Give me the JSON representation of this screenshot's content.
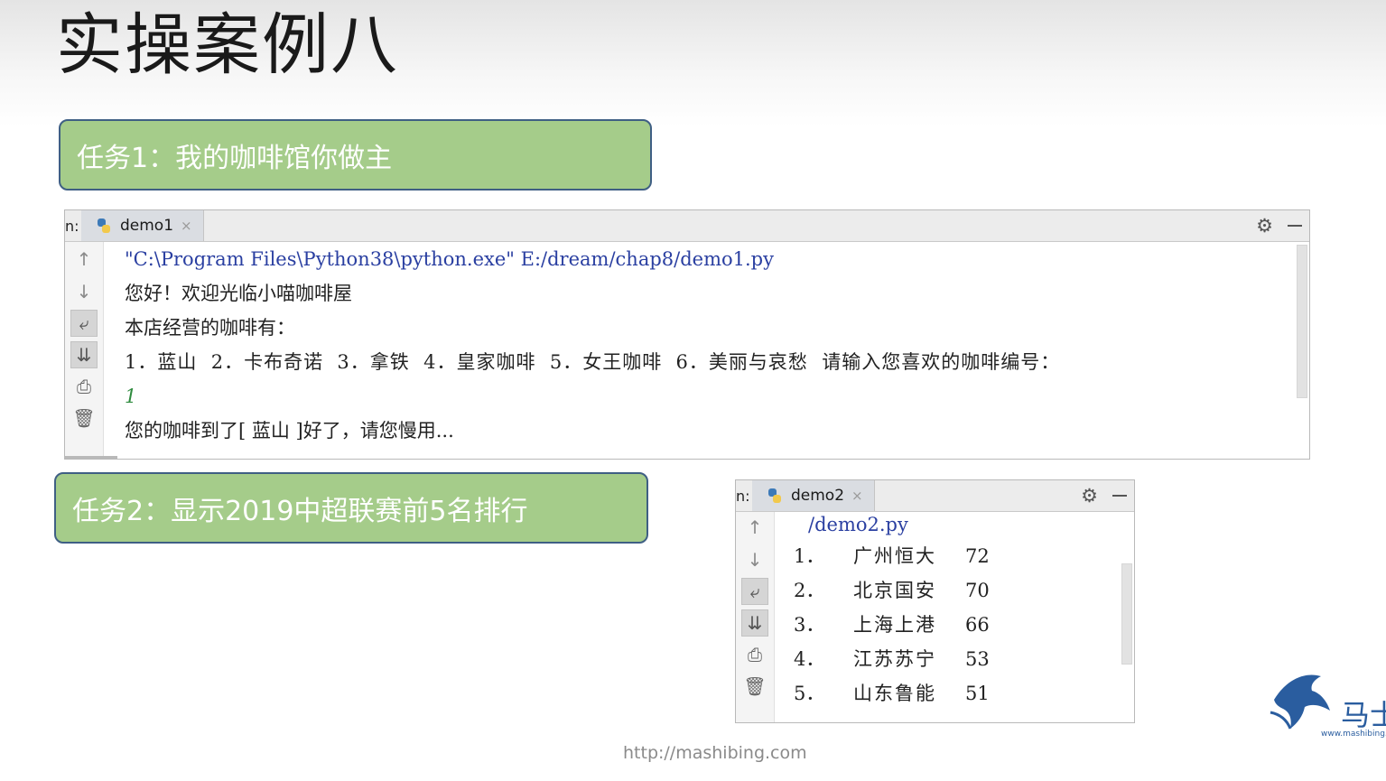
{
  "slide": {
    "title": "实操案例八",
    "footer_url": "http://mashibing.com"
  },
  "task1": {
    "label": "任务1：我的咖啡馆你做主"
  },
  "task2": {
    "label": "任务2：显示2019中超联赛前5名排行"
  },
  "panel1": {
    "tab_prefix": "n:",
    "tab_name": "demo1",
    "lines": [
      "\"C:\\Program Files\\Python38\\python.exe\" E:/dream/chap8/demo1.py",
      "您好！欢迎光临小喵咖啡屋",
      "本店经营的咖啡有：",
      "1．蓝山  2．卡布奇诺  3．拿铁  4．皇家咖啡  5．女王咖啡  6．美丽与哀愁  请输入您喜欢的咖啡编号：",
      "1",
      "您的咖啡到了[ 蓝山 ]好了，请您慢用..."
    ]
  },
  "panel2": {
    "tab_prefix": "n:",
    "tab_name": "demo2",
    "header_line": "/demo2.py",
    "rankings": [
      {
        "rank": "1．",
        "team": "广州恒大",
        "points": "72"
      },
      {
        "rank": "2．",
        "team": "北京国安",
        "points": "70"
      },
      {
        "rank": "3．",
        "team": "上海上港",
        "points": "66"
      },
      {
        "rank": "4．",
        "team": "江苏苏宁",
        "points": "53"
      },
      {
        "rank": "5．",
        "team": "山东鲁能",
        "points": "51"
      }
    ]
  },
  "logo": {
    "text": "马士兵",
    "sub": "www.mashibing.com"
  },
  "colors": {
    "task_fill": "#a5cc8a",
    "task_border": "#3f5f84",
    "path_text": "#2a3fa1",
    "input_text": "#2e8b3e",
    "logo_blue": "#2a5d9f"
  },
  "icons": {
    "gutter": [
      "arrow-up-icon",
      "arrow-down-icon",
      "soft-wrap-icon",
      "scroll-to-end-icon",
      "print-icon",
      "trash-icon"
    ],
    "tab": [
      "python-file-icon",
      "close-icon"
    ],
    "actions": [
      "gear-icon",
      "minimize-icon"
    ]
  }
}
